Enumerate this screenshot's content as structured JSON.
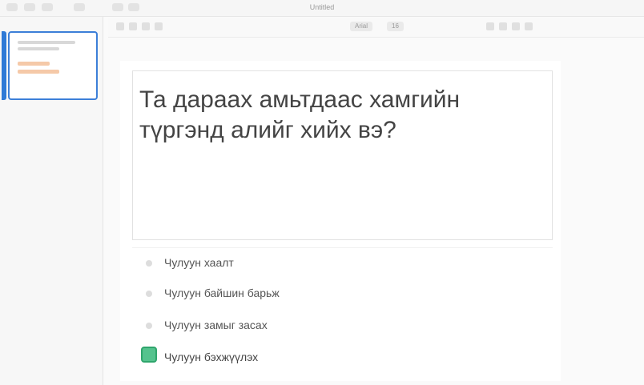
{
  "window": {
    "title": "Untitled"
  },
  "toolbar": {
    "font_label": "Arial",
    "size_label": "16"
  },
  "slide": {
    "question": "Та дараах амьтдаас хамгийн түргэнд алийг хийх вэ?",
    "answers": [
      {
        "label": "Чулуун хаалт",
        "selected": false
      },
      {
        "label": "Чулуун байшин барьж",
        "selected": false
      },
      {
        "label": "Чулуун замыг засах",
        "selected": false
      },
      {
        "label": "Чулуун бэхжүүлэх",
        "selected": true
      }
    ]
  },
  "colors": {
    "accent": "#3c7fd8",
    "selected": "#55c38e"
  }
}
